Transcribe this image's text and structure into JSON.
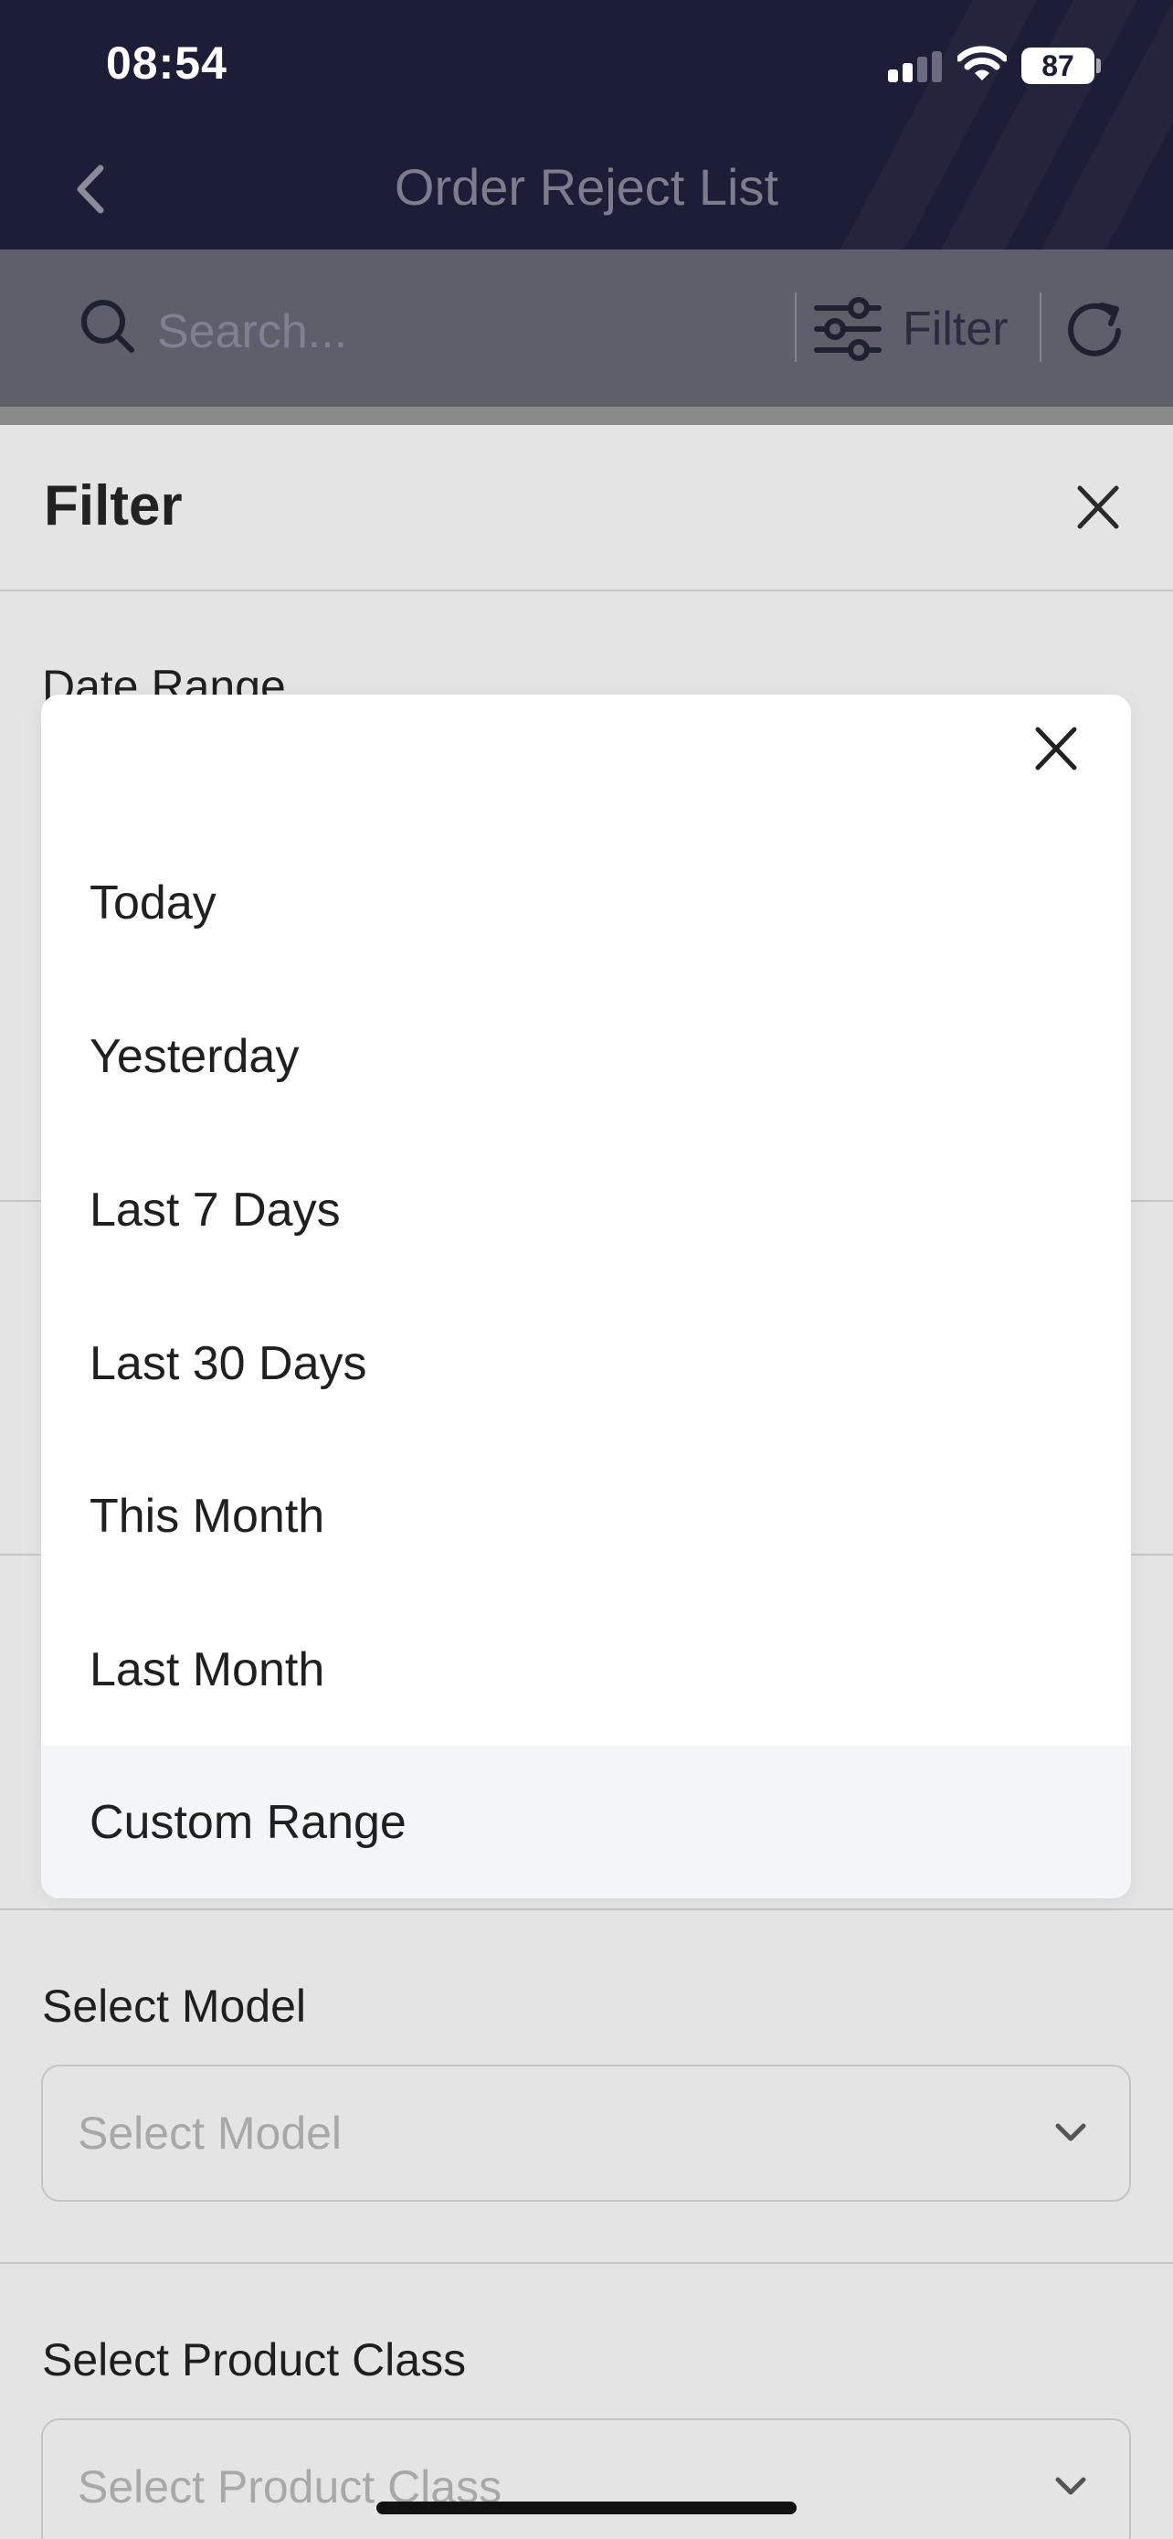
{
  "status_bar": {
    "time": "08:54",
    "battery": "87",
    "icons": [
      "signal-icon",
      "wifi-icon",
      "battery-icon"
    ]
  },
  "header": {
    "title": "Order Reject List",
    "back_icon": "chevron-left-icon"
  },
  "toolbar": {
    "search_placeholder": "Search...",
    "filter_label": "Filter",
    "icons": [
      "search-icon",
      "sliders-icon",
      "refresh-icon"
    ]
  },
  "filter_sheet": {
    "title": "Filter",
    "date_range_label": "Date Range",
    "model_label": "Select Model",
    "model_placeholder": "Select Model",
    "product_class_label": "Select Product Class",
    "product_class_placeholder": "Select Product Class"
  },
  "date_range_popup": {
    "options": [
      "Today",
      "Yesterday",
      "Last 7 Days",
      "Last 30 Days",
      "This Month",
      "Last Month",
      "Custom Range"
    ],
    "highlighted": "Custom Range"
  },
  "colors": {
    "header_bg": "#1c1d36",
    "overlay_bar": "#5e5f6a",
    "sheet_bg": "#e4e4e4",
    "popup_bg": "#ffffff",
    "highlight_bg": "#f4f5f7"
  }
}
